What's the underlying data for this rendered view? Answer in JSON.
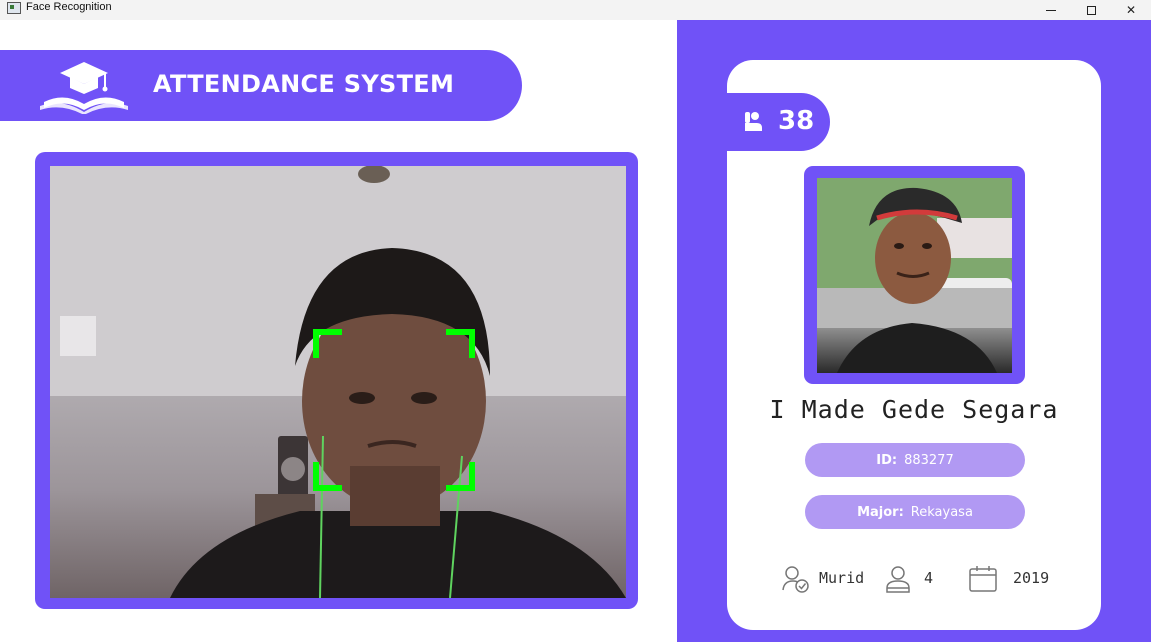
{
  "window": {
    "title": "Face Recognition",
    "controls": {
      "minimize": "minimize",
      "maximize": "maximize",
      "close": "✕"
    }
  },
  "header": {
    "title": "ATTENDANCE SYSTEM",
    "logo_icon": "graduation-book-icon"
  },
  "camera": {
    "face_box_color": "#00ff00"
  },
  "card": {
    "attendance_count": "38",
    "count_icon": "raised-hand-icon",
    "name": "I Made Gede Segara",
    "id_label": "ID:",
    "id_value": "883277",
    "major_label": "Major:",
    "major_value": "Rekayasa",
    "role_icon": "user-check-icon",
    "role": "Murid",
    "attendance_icon": "user-icon",
    "attendance_total": "4",
    "year_icon": "calendar-icon",
    "year": "2019"
  },
  "colors": {
    "accent": "#7052f7",
    "pill": "#b199f3"
  }
}
